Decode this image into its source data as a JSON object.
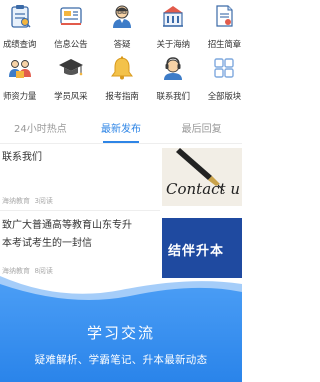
{
  "grid": {
    "row1": [
      {
        "label": "成绩查询",
        "icon": "clipboard-icon"
      },
      {
        "label": "信息公告",
        "icon": "news-icon"
      },
      {
        "label": "答疑",
        "icon": "teacher-icon"
      },
      {
        "label": "关于海纳",
        "icon": "building-icon"
      },
      {
        "label": "招生简章",
        "icon": "document-icon"
      }
    ],
    "row2": [
      {
        "label": "师资力量",
        "icon": "faculty-icon"
      },
      {
        "label": "学员风采",
        "icon": "graduation-cap-icon"
      },
      {
        "label": "报考指南",
        "icon": "bell-icon"
      },
      {
        "label": "联系我们",
        "icon": "call-center-icon"
      },
      {
        "label": "全部版块",
        "icon": "grid-icon"
      }
    ]
  },
  "tabs": [
    {
      "label": "24小时热点"
    },
    {
      "label": "最新发布"
    },
    {
      "label": "最后回复"
    }
  ],
  "list": [
    {
      "title": "联系我们",
      "source": "海纳教育",
      "reads": "3阅读",
      "thumb_text": "Contact u"
    },
    {
      "title_line1": "致广大普通高等教育山东专升",
      "title_line2": "本考试考生的一封信",
      "source": "海纳教育",
      "reads": "8阅读",
      "thumb_text": "结伴升本"
    }
  ],
  "banner": {
    "title": "学习交流",
    "subtitle": "疑难解析、学霸笔记、升本最新动态"
  },
  "colors": {
    "accent": "#2e85e6",
    "banner": "#2f8ef0"
  }
}
